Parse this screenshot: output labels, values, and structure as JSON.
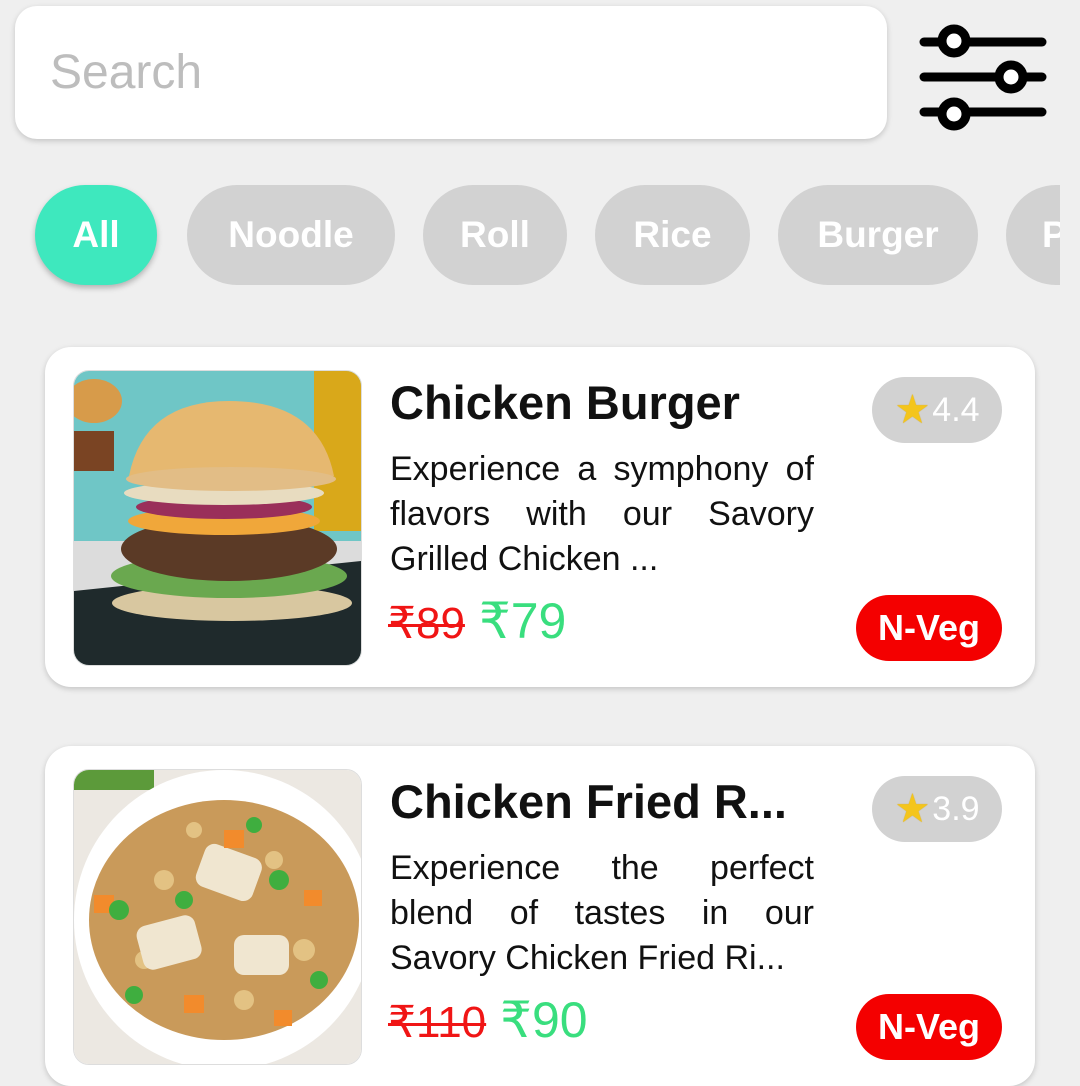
{
  "search": {
    "placeholder": "Search"
  },
  "filter": {
    "icon": "sliders-icon"
  },
  "categories": [
    {
      "label": "All",
      "active": true
    },
    {
      "label": "Noodle",
      "active": false
    },
    {
      "label": "Roll",
      "active": false
    },
    {
      "label": "Rice",
      "active": false
    },
    {
      "label": "Burger",
      "active": false
    },
    {
      "label": "P",
      "active": false
    }
  ],
  "items": [
    {
      "name": "Chicken Burger",
      "description": "Experience a symphony of flavors with our Savory Grilled Chicken ...",
      "old_price": "₹89",
      "new_price": "₹79",
      "rating": "4.4",
      "type_badge": "N-Veg"
    },
    {
      "name": "Chicken Fried R...",
      "description": "Experience the perfect blend of tastes in our Savory Chicken Fried Ri...",
      "old_price": "₹110",
      "new_price": "₹90",
      "rating": "3.9",
      "type_badge": "N-Veg"
    }
  ],
  "colors": {
    "accent": "#3ee8be",
    "chip_inactive": "#d2d2d2",
    "nonveg": "#f40000",
    "old_price": "#f01515",
    "new_price": "#39de7e"
  }
}
